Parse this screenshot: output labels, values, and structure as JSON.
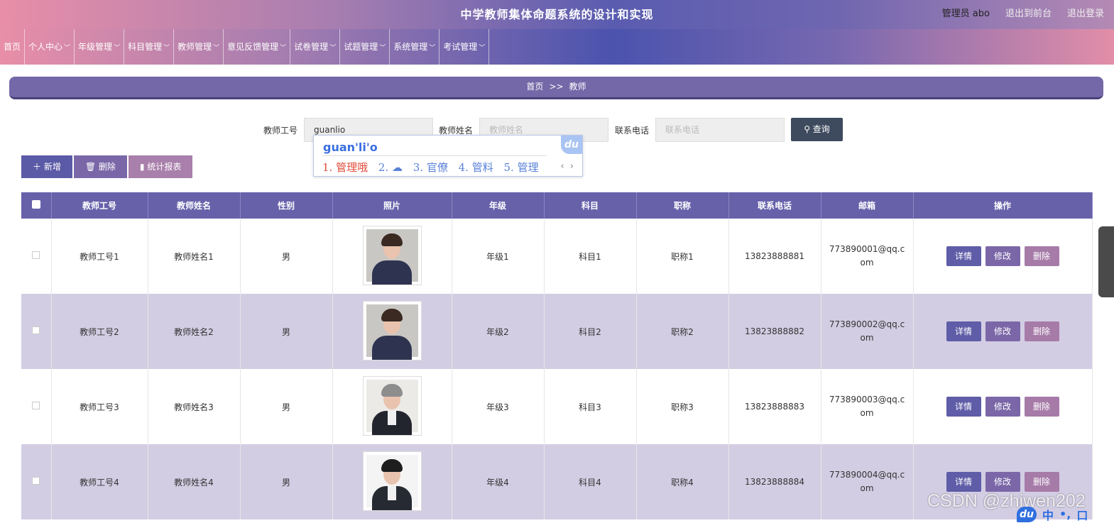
{
  "header": {
    "title": "中学教师集体命题系统的设计和实现",
    "user": "管理员 abo",
    "to_front": "退出到前台",
    "logout": "退出登录"
  },
  "nav": [
    {
      "label": "首页",
      "has_menu": false
    },
    {
      "label": "个人中心",
      "has_menu": true
    },
    {
      "label": "年级管理",
      "has_menu": true
    },
    {
      "label": "科目管理",
      "has_menu": true
    },
    {
      "label": "教师管理",
      "has_menu": true
    },
    {
      "label": "意见反馈管理",
      "has_menu": true
    },
    {
      "label": "试卷管理",
      "has_menu": true
    },
    {
      "label": "试题管理",
      "has_menu": true
    },
    {
      "label": "系统管理",
      "has_menu": true
    },
    {
      "label": "考试管理",
      "has_menu": true
    }
  ],
  "breadcrumb": {
    "home": "首页",
    "sep": ">>",
    "current": "教师"
  },
  "search": {
    "teacher_no_label": "教师工号",
    "teacher_no_value": "guanlio",
    "teacher_name_label": "教师姓名",
    "teacher_name_placeholder": "教师姓名",
    "phone_label": "联系电话",
    "phone_placeholder": "联系电话",
    "query_label": "查询"
  },
  "ime": {
    "pinyin": "guan'li'o",
    "candidates": [
      "1. 管理哦",
      "2. ☁",
      "3. 官僚",
      "4. 管料",
      "5. 管理"
    ],
    "logo": "du"
  },
  "actions": {
    "add": "新增",
    "delete": "删除",
    "report": "统计报表"
  },
  "colors": {
    "add": "#5b5aa6",
    "delete": "#7a67a8",
    "report": "#a97fab",
    "detail": "#5f5ca8",
    "edit": "#7b67a8",
    "remove": "#a67ba8"
  },
  "table": {
    "headers": [
      "教师工号",
      "教师姓名",
      "性别",
      "照片",
      "年级",
      "科目",
      "职称",
      "联系电话",
      "邮箱",
      "操作"
    ],
    "rows": [
      {
        "no": "教师工号1",
        "name": "教师姓名1",
        "gender": "男",
        "grade": "年级1",
        "subject": "科目1",
        "title": "职称1",
        "phone": "13823888881",
        "email": "773890001@qq.com"
      },
      {
        "no": "教师工号2",
        "name": "教师姓名2",
        "gender": "男",
        "grade": "年级2",
        "subject": "科目2",
        "title": "职称2",
        "phone": "13823888882",
        "email": "773890002@qq.com"
      },
      {
        "no": "教师工号3",
        "name": "教师姓名3",
        "gender": "男",
        "grade": "年级3",
        "subject": "科目3",
        "title": "职称3",
        "phone": "13823888883",
        "email": "773890003@qq.com"
      },
      {
        "no": "教师工号4",
        "name": "教师姓名4",
        "gender": "男",
        "grade": "年级4",
        "subject": "科目4",
        "title": "职称4",
        "phone": "13823888884",
        "email": "773890004@qq.com"
      }
    ],
    "ops": {
      "detail": "详情",
      "edit": "修改",
      "remove": "删除"
    }
  },
  "watermark": "CSDN @zhiwen202",
  "tray": {
    "logo": "du",
    "lang": "中",
    "punct": "•,",
    "more": "口"
  }
}
